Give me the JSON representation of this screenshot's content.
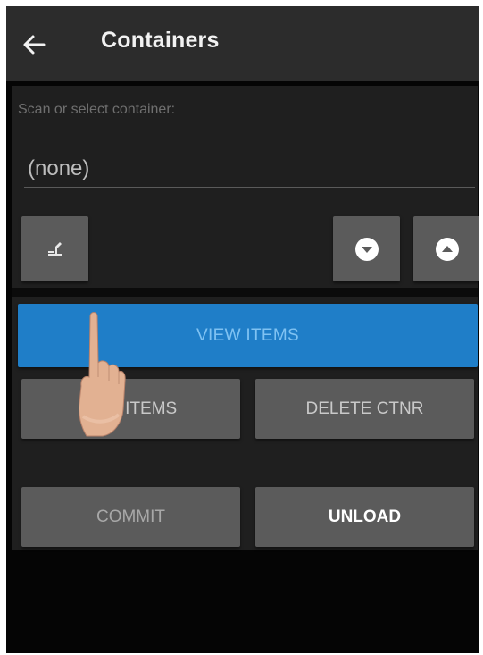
{
  "appbar": {
    "title": "Containers",
    "back_icon": "arrow-left-icon"
  },
  "scan": {
    "label": "Scan or select container:",
    "value": "(none)"
  },
  "icons": {
    "scan": "scan-trigger-icon",
    "down": "circle-chevron-down-icon",
    "up": "circle-chevron-up-icon"
  },
  "buttons": {
    "view_items": "VIEW ITEMS",
    "add_items": "ADD ITEMS",
    "delete_ctnr": "DELETE CTNR",
    "commit": "COMMIT",
    "unload": "UNLOAD"
  },
  "colors": {
    "accent": "#1f7ec8",
    "button": "#5b5b5b",
    "appbar": "#2c2c2c"
  }
}
